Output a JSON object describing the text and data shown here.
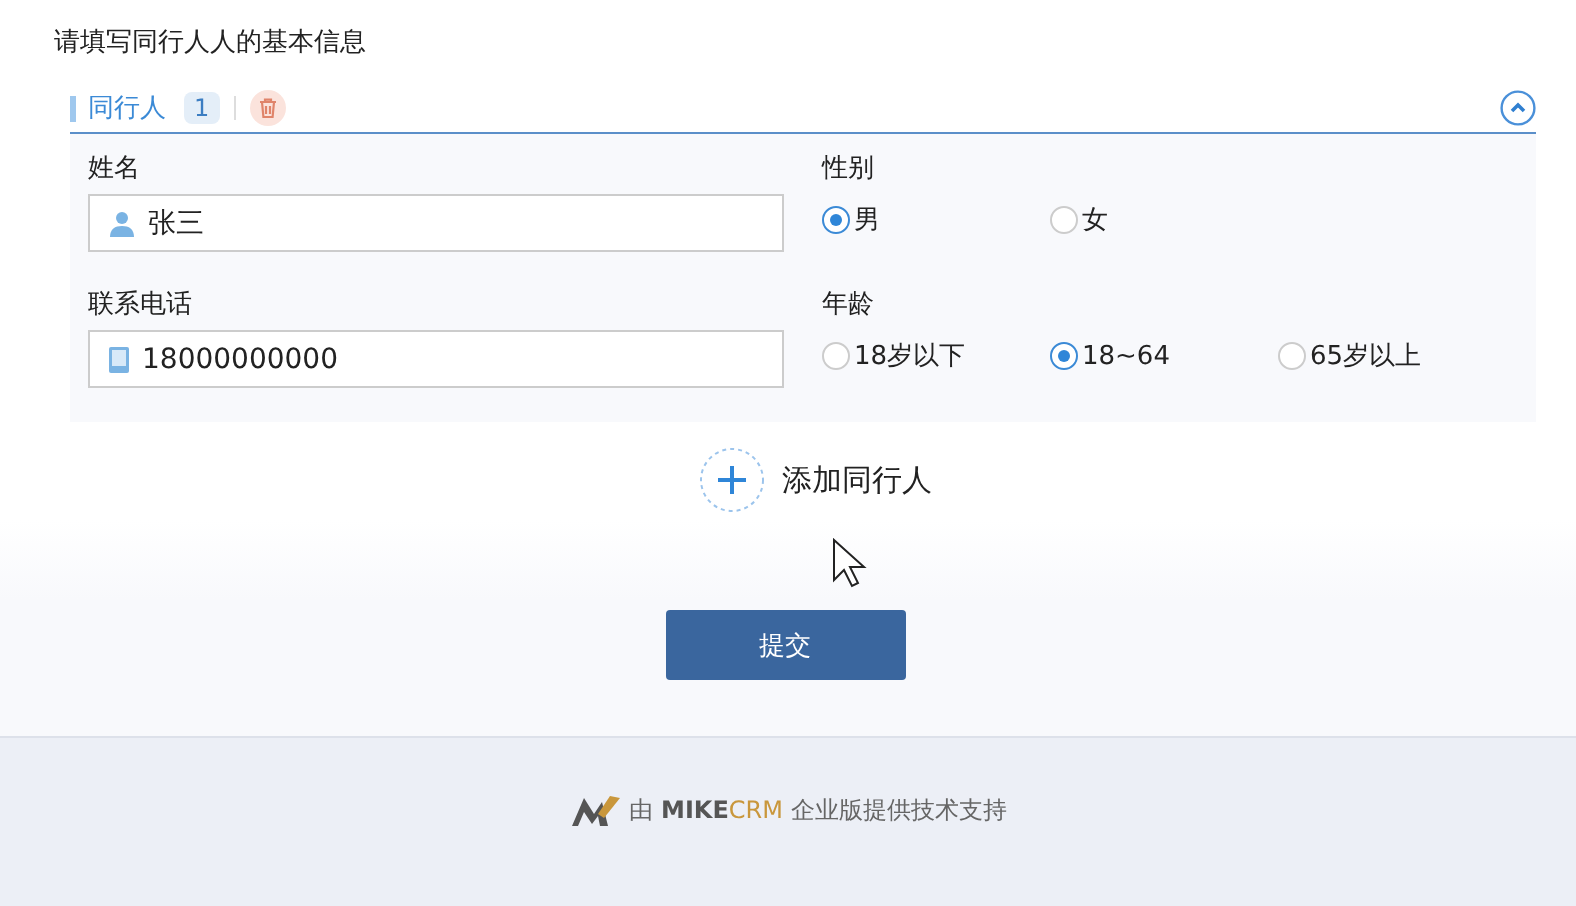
{
  "heading": "请填写同行人人的基本信息",
  "companion": {
    "title": "同行人",
    "count": "1",
    "expanded": true,
    "fields": [
      {
        "kind": "person",
        "label": "姓名",
        "value": "张三"
      },
      {
        "kind": "radio",
        "label": "性别",
        "options": [
          {
            "label": "男",
            "selected": true
          },
          {
            "label": "女",
            "selected": false
          }
        ]
      },
      {
        "kind": "phone",
        "label": "联系电话",
        "value": "18000000000"
      },
      {
        "kind": "radio",
        "label": "年龄",
        "options": [
          {
            "label": "18岁以下",
            "selected": false
          },
          {
            "label": "18~64",
            "selected": true
          },
          {
            "label": "65岁以上",
            "selected": false
          }
        ]
      }
    ]
  },
  "add_button": "添加同行人",
  "submit": "提交",
  "footer": {
    "prefix": "由",
    "brand_first": "MIKE",
    "brand_second": "CRM",
    "suffix": "企业版提供技术支持"
  }
}
